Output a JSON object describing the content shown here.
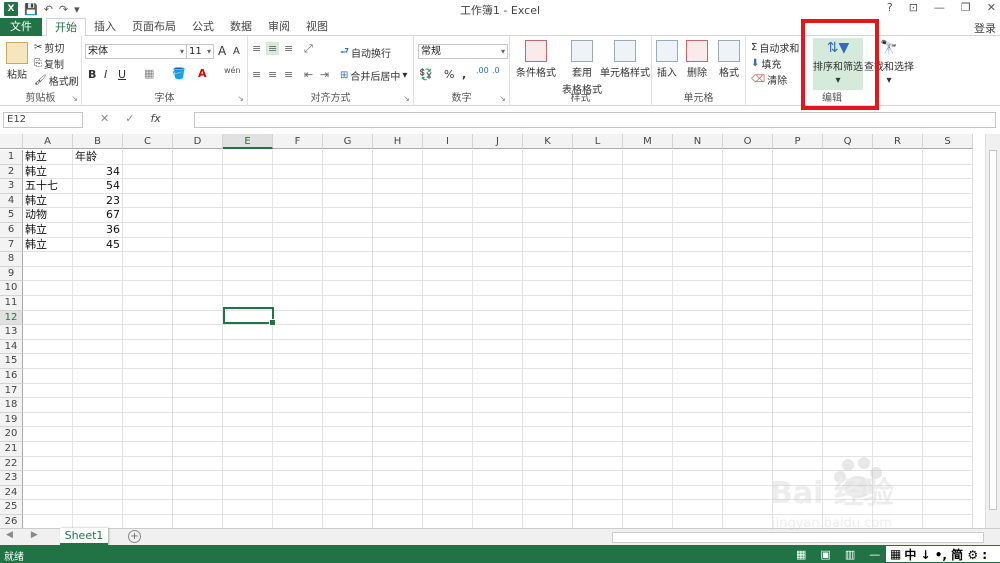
{
  "window": {
    "title": "工作簿1 - Excel",
    "help": "?",
    "ribbon_opt": "⊡",
    "minimize": "—",
    "restore": "❐",
    "close": "✕"
  },
  "qat": {
    "logo": "X",
    "save": "💾",
    "undo": "↶",
    "redo": "↷",
    "more": "▾"
  },
  "tabs": [
    "文件",
    "开始",
    "插入",
    "页面布局",
    "公式",
    "数据",
    "审阅",
    "视图"
  ],
  "login": "登录",
  "ribbon": {
    "clipboard": {
      "label": "剪贴板",
      "paste": "粘贴",
      "cut": "剪切",
      "copy": "复制",
      "format_painter": "格式刷"
    },
    "font": {
      "label": "字体",
      "name": "宋体",
      "size": "11",
      "bold": "B",
      "italic": "I",
      "underline": "U",
      "grow": "A",
      "shrink": "A"
    },
    "alignment": {
      "label": "对齐方式",
      "wrap": "自动换行",
      "merge": "合并后居中"
    },
    "number": {
      "label": "数字",
      "format": "常规",
      "percent": "%",
      "comma": ","
    },
    "styles": {
      "label": "样式",
      "conditional": "条件格式",
      "table_format_1": "套用",
      "table_format_2": "表格格式",
      "cell_styles": "单元格样式"
    },
    "cells": {
      "label": "单元格",
      "insert": "插入",
      "delete": "删除",
      "format": "格式"
    },
    "editing": {
      "label": "编辑",
      "autosum": "自动求和",
      "fill": "填充",
      "clear": "清除",
      "sort_filter": "排序和筛选",
      "find_select": "查找和选择"
    }
  },
  "formula_bar": {
    "name_box": "E12",
    "cancel": "✕",
    "enter": "✓",
    "fx": "fx",
    "value": ""
  },
  "columns": [
    "A",
    "B",
    "C",
    "D",
    "E",
    "F",
    "G",
    "H",
    "I",
    "J",
    "K",
    "L",
    "M",
    "N",
    "O",
    "P",
    "Q",
    "R",
    "S"
  ],
  "selected_column": "E",
  "selected_row": 12,
  "rows": [
    "1",
    "2",
    "3",
    "4",
    "5",
    "6",
    "7",
    "8",
    "9",
    "10",
    "11",
    "12",
    "13",
    "14",
    "15",
    "16",
    "17",
    "18",
    "19",
    "20",
    "21",
    "22",
    "23",
    "24",
    "25",
    "26"
  ],
  "table": {
    "rows": [
      [
        "韩立",
        "年龄"
      ],
      [
        "韩立",
        "34"
      ],
      [
        "五十七",
        "54"
      ],
      [
        "韩立",
        "23"
      ],
      [
        "动物",
        "67"
      ],
      [
        "韩立",
        "36"
      ],
      [
        "韩立",
        "45"
      ]
    ]
  },
  "sheets": [
    "Sheet1"
  ],
  "add_sheet": "+",
  "status": {
    "text": "就绪",
    "ime": "中 ↓ •, 简 ⚙ :"
  },
  "watermark": {
    "brand": "Bai 经验",
    "url": "jingyan.baidu.com"
  }
}
